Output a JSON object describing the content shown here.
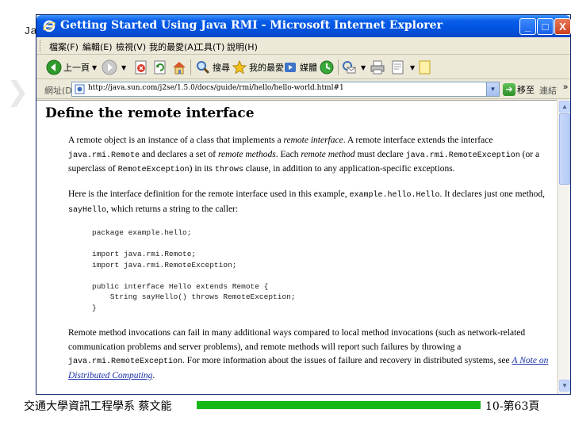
{
  "slide": {
    "title_fragment": "Ja",
    "footer_left": "交通大學資訊工程學系 蔡文能",
    "footer_right": "10-第63頁"
  },
  "window": {
    "title": "Getting Started Using Java RMI - Microsoft Internet Explorer",
    "buttons": {
      "minimize": "_",
      "maximize": "□",
      "close": "X"
    }
  },
  "menu": {
    "items": [
      "檔案(F)",
      "編輯(E)",
      "檢視(V)",
      "我的最愛(A)",
      "工具(T)",
      "說明(H)"
    ]
  },
  "toolbar": {
    "back_label": "上一頁",
    "search_label": "搜尋",
    "favorites_label": "我的最愛",
    "media_label": "媒體"
  },
  "address": {
    "label": "網址(D)",
    "url": "http://java.sun.com/j2se/1.5.0/docs/guide/rmi/hello/hello-world.html#1",
    "go_label": "移至",
    "links_label": "連結",
    "links_more": "»"
  },
  "page": {
    "heading": "Define the remote interface",
    "p1": {
      "t1": "A remote object is an instance of a class that implements a ",
      "t2": "remote interface",
      "t3": ". A remote interface extends the interface ",
      "c1": "java.rmi.Remote",
      "t4": " and declares a set of ",
      "t5": "remote methods",
      "t6": ". Each ",
      "t7": "remote method",
      "t8": " must declare ",
      "c2": "java.rmi.RemoteException",
      "t9": " (or a superclass of ",
      "c3": "RemoteException",
      "t10": ") in its ",
      "c4": "throws",
      "t11": " clause, in addition to any application-specific exceptions."
    },
    "p2": {
      "t1": "Here is the interface definition for the remote interface used in this example, ",
      "c1": "example.hello.Hello",
      "t2": ". It declares just one method, ",
      "c2": "sayHello",
      "t3": ", which returns a string to the caller:"
    },
    "code": "package example.hello;\n\nimport java.rmi.Remote;\nimport java.rmi.RemoteException;\n\npublic interface Hello extends Remote {\n    String sayHello() throws RemoteException;\n}",
    "p3": {
      "t1": "Remote method invocations can fail in many additional ways compared to local method invocations (such as network-related communication problems and server problems), and remote methods will report such failures by throwing a ",
      "c1": "java.rmi.RemoteException",
      "t2": ". For more information about the issues of failure and recovery in distributed systems, see ",
      "link": "A Note on Distributed Computing",
      "t3": "."
    }
  }
}
